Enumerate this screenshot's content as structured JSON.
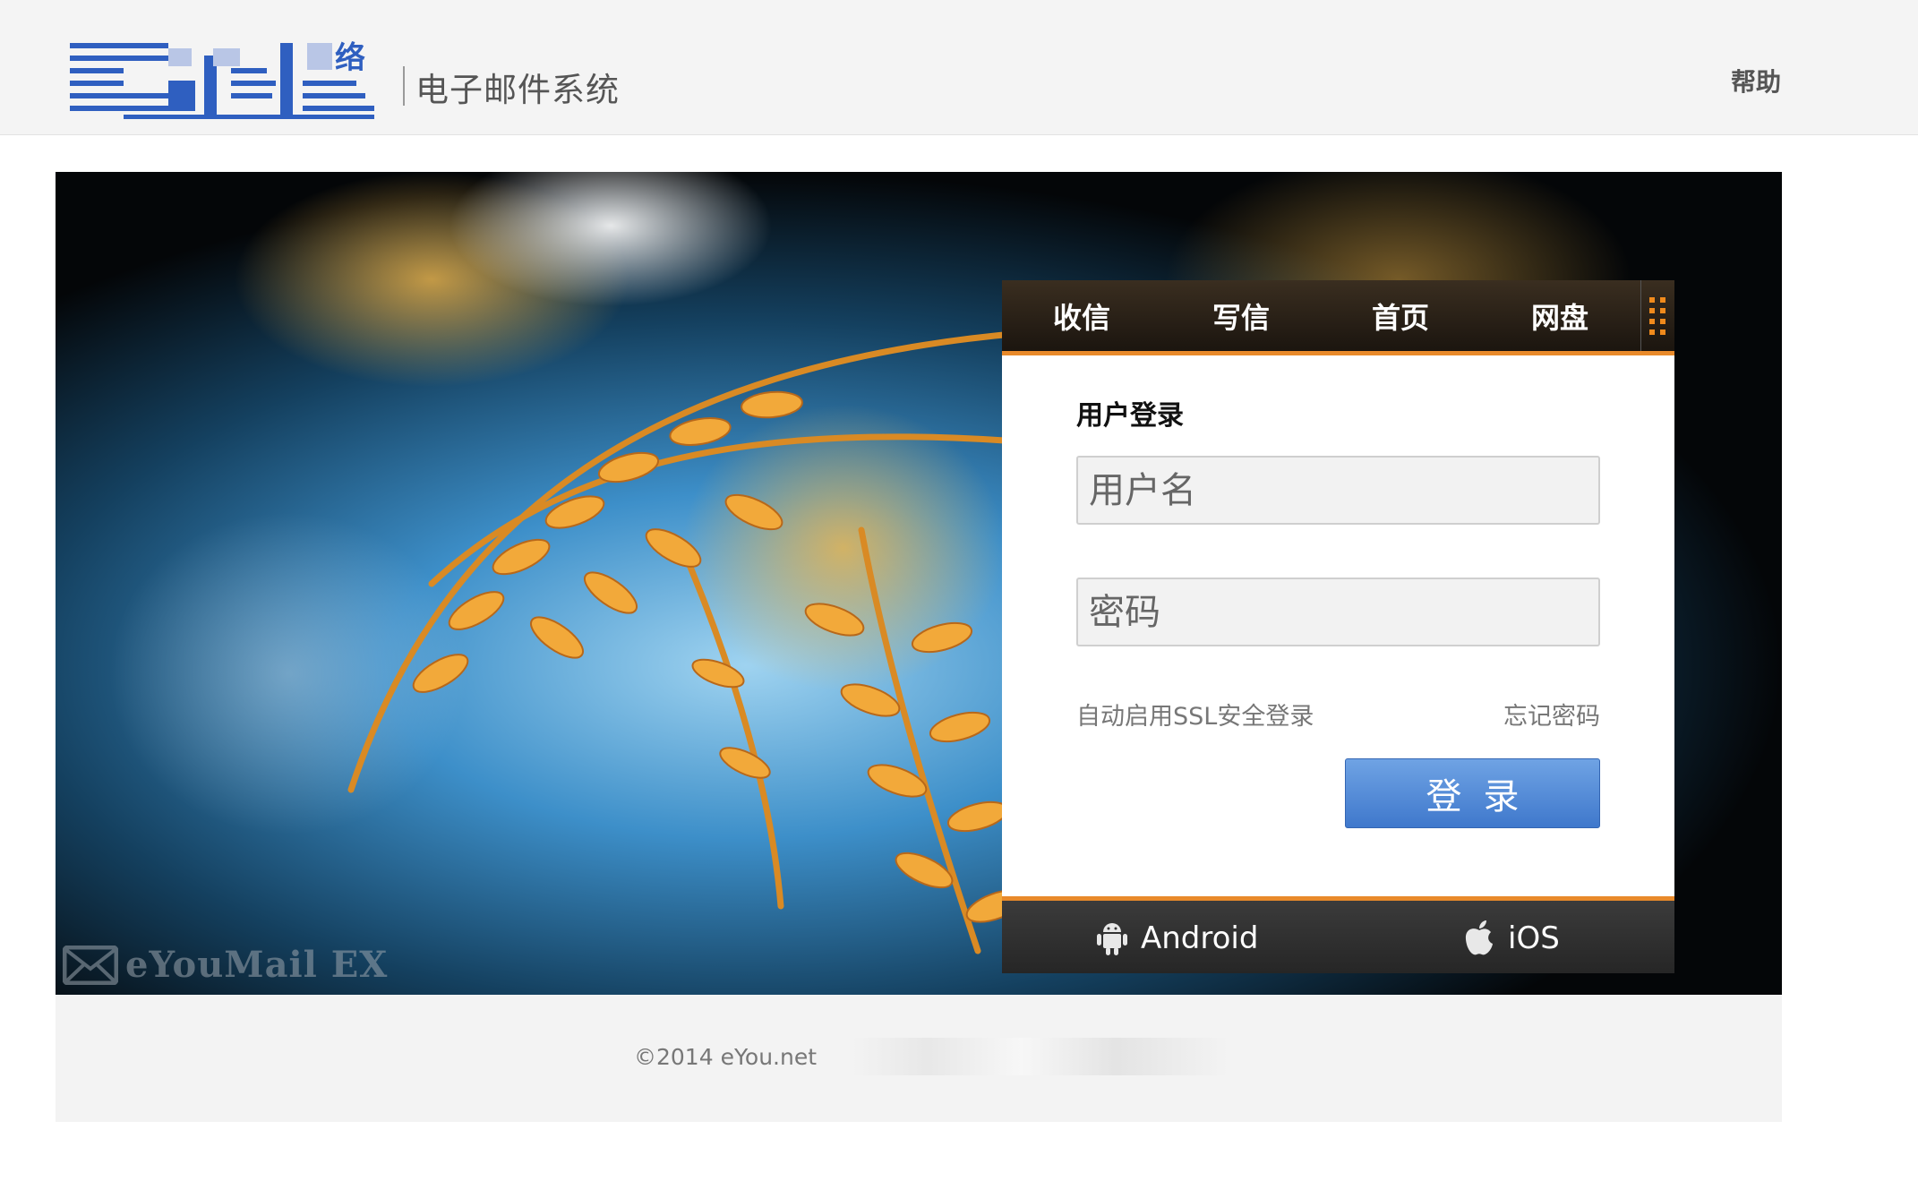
{
  "header": {
    "logo_icon": "network-logo-icon",
    "logo_glyph": "络",
    "system_title": "电子邮件系统",
    "help_label": "帮助"
  },
  "banner": {
    "background": "leaf-photo",
    "watermark_icon": "envelope-icon",
    "watermark_text": "eYouMail EX"
  },
  "panel": {
    "nav": [
      {
        "label": "收信"
      },
      {
        "label": "写信"
      },
      {
        "label": "首页"
      },
      {
        "label": "网盘"
      }
    ],
    "more_icon": "grid-dots-icon",
    "login_heading": "用户登录",
    "username_placeholder": "用户名",
    "password_placeholder": "密码",
    "ssl_label": "自动启用SSL安全登录",
    "forgot_label": "忘记密码",
    "login_button": "登录",
    "apps": [
      {
        "label": "Android",
        "icon": "android-icon"
      },
      {
        "label": "iOS",
        "icon": "apple-icon"
      }
    ]
  },
  "footer": {
    "copyright": "©2014 eYou.net"
  },
  "colors": {
    "accent_orange": "#e98a2a",
    "button_blue": "#4a82d4",
    "logo_blue": "#2f5fc0"
  }
}
